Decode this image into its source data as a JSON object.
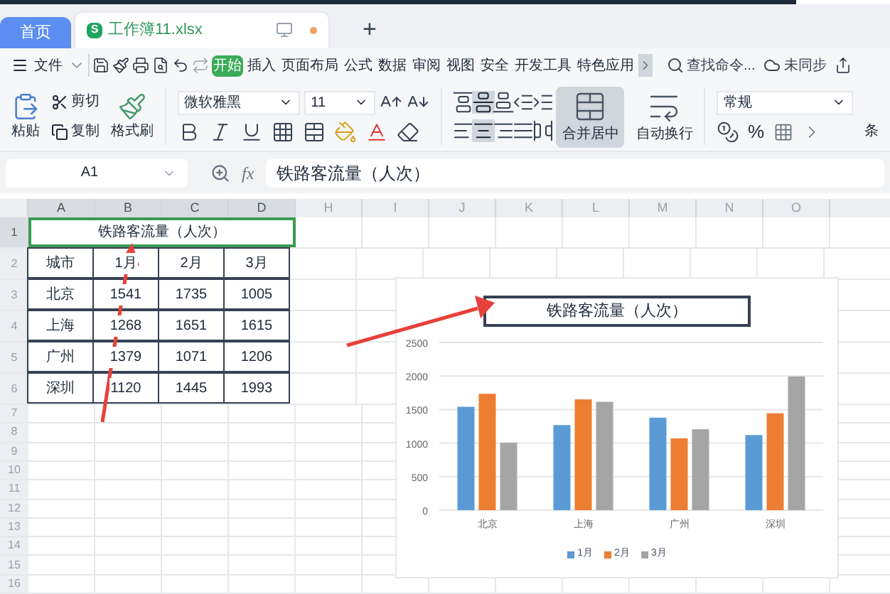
{
  "tabs": [
    {
      "kind": "home",
      "label": "首页",
      "selected": false
    },
    {
      "kind": "document",
      "label": "工作簿11.xlsx",
      "icon_letter": "S",
      "selected": true,
      "modified": true
    }
  ],
  "new_tab": "+",
  "menu": {
    "file": "文件",
    "tabs": [
      {
        "label": "开始",
        "selected": true
      },
      {
        "label": "插入",
        "selected": false
      },
      {
        "label": "页面布局",
        "selected": false
      },
      {
        "label": "公式",
        "selected": false
      },
      {
        "label": "数据",
        "selected": false
      },
      {
        "label": "审阅",
        "selected": false
      },
      {
        "label": "视图",
        "selected": false
      },
      {
        "label": "安全",
        "selected": false
      },
      {
        "label": "开发工具",
        "selected": false
      },
      {
        "label": "特色应用",
        "selected": false
      }
    ],
    "search": "查找命令...",
    "sync": "未同步"
  },
  "ribbon": {
    "paste": "粘贴",
    "cut": "剪切",
    "copy": "复制",
    "format_painter": "格式刷",
    "font_name": "微软雅黑",
    "font_size": "11",
    "merge": "合并居中",
    "merge_selected": true,
    "wrap": "自动换行",
    "number_format": "常规",
    "percent": "%",
    "cut_off": "条"
  },
  "formula_bar": {
    "name_box": "A1",
    "fx": "fx",
    "formula": "铁路客流量（人次）"
  },
  "sheet": {
    "columns": [
      {
        "label": "A",
        "selected": true
      },
      {
        "label": "B",
        "selected": true
      },
      {
        "label": "C",
        "selected": true
      },
      {
        "label": "D",
        "selected": true
      },
      {
        "label": "H",
        "selected": false
      },
      {
        "label": "I",
        "selected": false
      },
      {
        "label": "J",
        "selected": false
      },
      {
        "label": "K",
        "selected": false
      },
      {
        "label": "L",
        "selected": false
      },
      {
        "label": "M",
        "selected": false
      },
      {
        "label": "N",
        "selected": false
      },
      {
        "label": "O",
        "selected": false
      }
    ],
    "rows": [
      {
        "label": "1",
        "selected": true
      },
      {
        "label": "2",
        "selected": false
      },
      {
        "label": "3",
        "selected": false
      },
      {
        "label": "4",
        "selected": false
      },
      {
        "label": "5",
        "selected": false
      },
      {
        "label": "6",
        "selected": false
      },
      {
        "label": "7",
        "selected": false
      },
      {
        "label": "8",
        "selected": false
      },
      {
        "label": "9",
        "selected": false
      },
      {
        "label": "10",
        "selected": false
      },
      {
        "label": "11",
        "selected": false
      },
      {
        "label": "12",
        "selected": false
      },
      {
        "label": "13",
        "selected": false
      },
      {
        "label": "14",
        "selected": false
      },
      {
        "label": "15",
        "selected": false
      },
      {
        "label": "16",
        "selected": false
      }
    ],
    "title_cell": {
      "text": "铁路客流量（人次）",
      "selected": true
    },
    "table": [
      [
        "城市",
        "1月",
        "2月",
        "3月"
      ],
      [
        "北京",
        "1541",
        "1735",
        "1005"
      ],
      [
        "上海",
        "1268",
        "1651",
        "1615"
      ],
      [
        "广州",
        "1379",
        "1071",
        "1206"
      ],
      [
        "深圳",
        "1120",
        "1445",
        "1993"
      ]
    ]
  },
  "chart": {
    "chart_data": {
      "type": "bar",
      "title": "铁路客流量（人次）",
      "categories": [
        "北京",
        "上海",
        "广州",
        "深圳"
      ],
      "series": [
        {
          "name": "1月",
          "color": "#5b9bd5",
          "values": [
            1541,
            1268,
            1379,
            1120
          ]
        },
        {
          "name": "2月",
          "color": "#ed7d31",
          "values": [
            1735,
            1651,
            1071,
            1445
          ]
        },
        {
          "name": "3月",
          "color": "#a5a5a5",
          "values": [
            1005,
            1615,
            1206,
            1993
          ]
        }
      ],
      "ylim": [
        0,
        2500
      ],
      "yticks": [
        0,
        500,
        1000,
        1500,
        2000,
        2500
      ],
      "grid": true,
      "legend": true
    }
  }
}
